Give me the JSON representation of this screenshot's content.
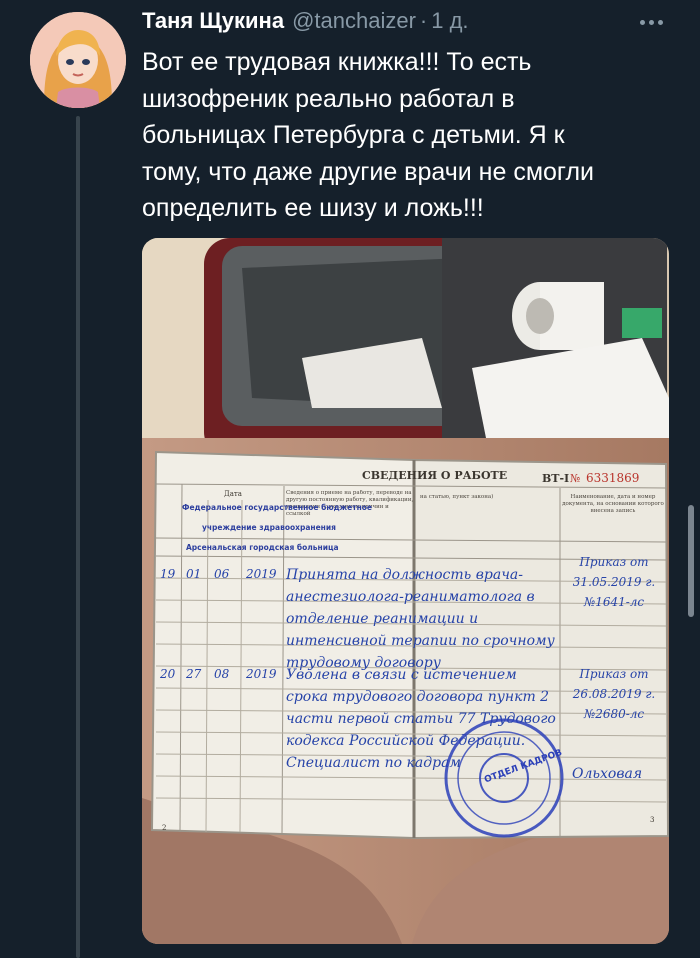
{
  "tweet": {
    "author_name": "Таня Щукина",
    "author_handle": "@tanchaizer",
    "separator": "·",
    "time": "1 д.",
    "text_lines": [
      "Вот ее трудовая книжка!!! То есть",
      "шизофреник реально работал в",
      "больницах Петербурга с детьми. Я к",
      "тому, что даже другие врачи не смогли",
      "определить ее шизу и ложь!!!"
    ]
  },
  "photo": {
    "page_heading": "СВЕДЕНИЯ О РАБОТЕ",
    "form_code": "ВТ-I",
    "number_sign": "№",
    "serial": "6331869",
    "col_date": "Дата",
    "col_info_left": "Сведения о приеме на работу, переводе на другую постоянную работу, квалификации, увольнении (с указанием причин и ссылкой",
    "col_info_right": "на статью, пункт закона)",
    "col_doc": "Наименование, дата и номер документа, на основании которого внесена запись",
    "org_line1": "Федеральное государственное бюджетное",
    "org_line2": "учреждение здравоохранения",
    "org_line3": "Арсенальская городская больница",
    "rows": [
      {
        "num": "19",
        "day": "01",
        "month": "06",
        "year": "2019",
        "text": "Принята на должность врача-анестезиолога-реаниматолога в отделение реанимации и интенсивной терапии по срочному трудовому договору",
        "doc": "Приказ от 31.05.2019 г. №1641-лс"
      },
      {
        "num": "20",
        "day": "27",
        "month": "08",
        "year": "2019",
        "text": "Уволена в связи с истечением срока трудового договора пункт 2 части первой статьи 77 Трудового кодекса Российской Федерации. Специалист по кадрам",
        "doc": "Приказ от 26.08.2019 г. №2680-лс"
      }
    ],
    "stamp_text": "ОТДЕЛ КАДРОВ",
    "stamp_signature": "Ольховая",
    "left_page_number": "2",
    "right_page_number": "3"
  }
}
